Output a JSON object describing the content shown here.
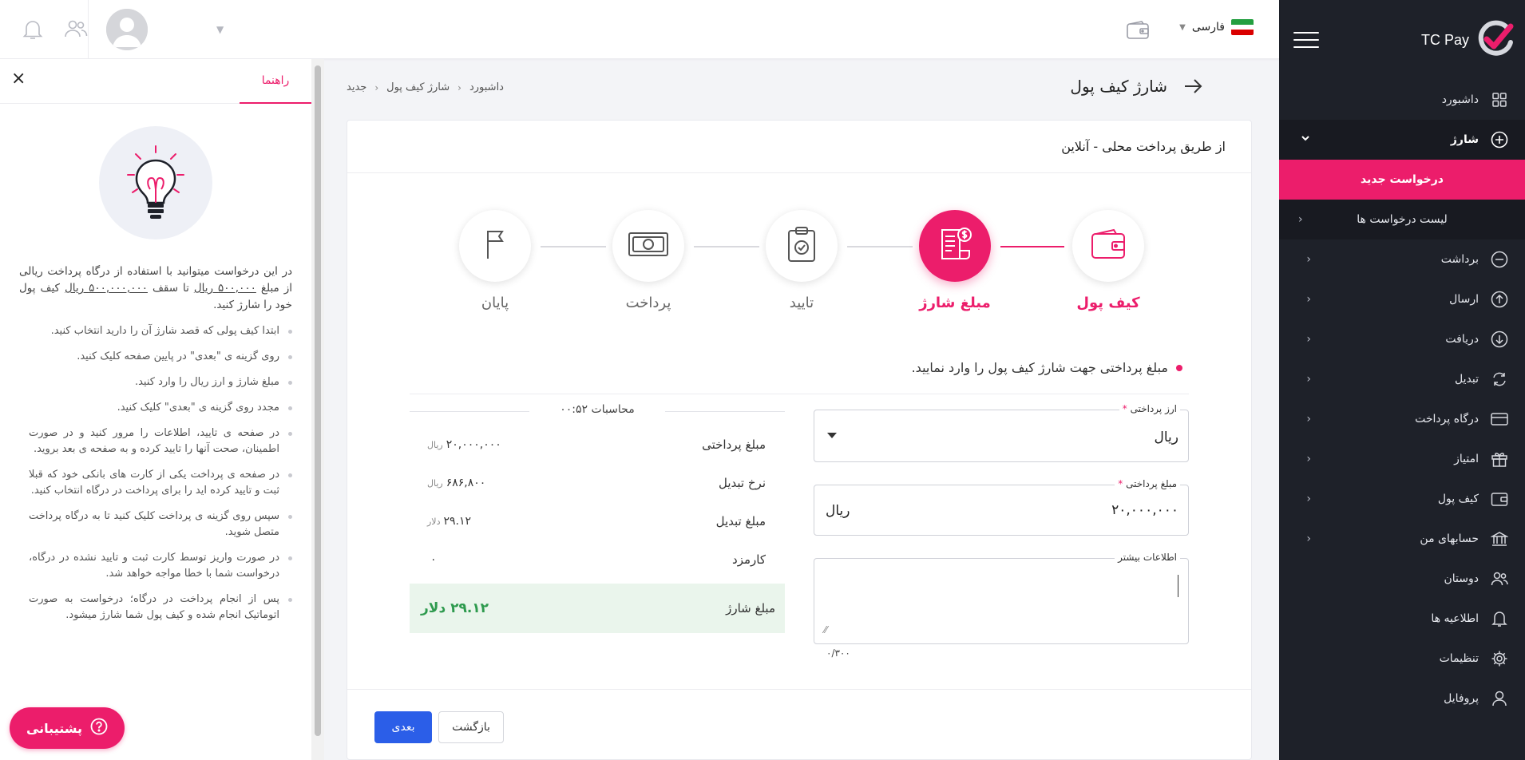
{
  "brand": {
    "name": "TC Pay"
  },
  "sidebar": {
    "items": [
      {
        "label": "داشبورد",
        "icon": "grid-icon"
      },
      {
        "label": "شارژ",
        "icon": "plus-circle-icon",
        "open": true,
        "sub": [
          {
            "label": "درخواست جدید",
            "active": true
          },
          {
            "label": "لیست درخواست ها"
          }
        ]
      },
      {
        "label": "برداشت",
        "icon": "minus-circle-icon"
      },
      {
        "label": "ارسال",
        "icon": "arrow-up-circle-icon"
      },
      {
        "label": "دریافت",
        "icon": "arrow-down-circle-icon"
      },
      {
        "label": "تبدیل",
        "icon": "refresh-icon"
      },
      {
        "label": "درگاه پرداخت",
        "icon": "card-icon"
      },
      {
        "label": "امتیاز",
        "icon": "gift-icon"
      },
      {
        "label": "کیف پول",
        "icon": "wallet-icon"
      },
      {
        "label": "حسابهای من",
        "icon": "bank-icon"
      },
      {
        "label": "دوستان",
        "icon": "users-icon"
      },
      {
        "label": "اطلاعیه ها",
        "icon": "bell-icon"
      },
      {
        "label": "تنظیمات",
        "icon": "gear-icon"
      },
      {
        "label": "پروفایل",
        "icon": "user-icon"
      }
    ]
  },
  "topbar": {
    "language": "فارسی"
  },
  "page": {
    "title": "شارژ کیف پول",
    "breadcrumb": [
      "داشبورد",
      "شارژ کیف پول",
      "جدید"
    ],
    "card_title": "از طریق پرداخت محلی - آنلاین"
  },
  "steps": [
    {
      "label": "کیف پول",
      "state": "done"
    },
    {
      "label": "مبلغ شارژ",
      "state": "active"
    },
    {
      "label": "تایید",
      "state": "pending"
    },
    {
      "label": "پرداخت",
      "state": "pending"
    },
    {
      "label": "پایان",
      "state": "pending"
    }
  ],
  "form": {
    "instruction": "مبلغ پرداختی جهت شارژ کیف پول را وارد نمایید.",
    "currency_label": "ارز پرداختی",
    "currency_value": "ریال",
    "amount_label": "مبلغ پرداختی",
    "amount_value": "۲۰,۰۰۰,۰۰۰",
    "amount_unit": "ریال",
    "more_label": "اطلاعات بیشتر",
    "more_value": "",
    "char_count": "۰/۳۰۰",
    "required_mark": "*"
  },
  "calc": {
    "title": "محاسبات ۰۰:۵۲",
    "rows": [
      {
        "label": "مبلغ پرداختی",
        "value": "۲۰,۰۰۰,۰۰۰",
        "unit": "ریال"
      },
      {
        "label": "نرخ تبدیل",
        "value": "۶۸۶,۸۰۰",
        "unit": "ریال"
      },
      {
        "label": "مبلغ تبدیل",
        "value": "۲۹.۱۲",
        "unit": "دلار"
      },
      {
        "label": "کارمزد",
        "value": "۰",
        "unit": ""
      }
    ],
    "total_label": "مبلغ شارژ",
    "total_value": "۲۹.۱۲ دلار"
  },
  "buttons": {
    "next": "بعدی",
    "back": "بازگشت"
  },
  "help": {
    "tab": "راهنما",
    "intro_1": "در این درخواست میتوانید با استفاده از درگاه پرداخت ریالی از مبلغ",
    "intro_min": "۵۰۰,۰۰۰ ریال",
    "intro_2": "تا سقف",
    "intro_max": "۵۰۰,۰۰۰,۰۰۰ ریال",
    "intro_3": "کیف پول خود را شارژ کنید.",
    "list": [
      "ابتدا کیف پولی که قصد شارژ آن را دارید انتخاب کنید.",
      "روی گزینه ی \"بعدی\" در پایین صفحه کلیک کنید.",
      "مبلغ شارژ و ارز ریال را وارد کنید.",
      "مجدد روی گزینه ی \"بعدی\" کلیک کنید.",
      "در صفحه ی تایید، اطلاعات را مرور کنید و در صورت اطمینان، صحت آنها را تایید کرده و به صفحه ی بعد بروید.",
      "در صفحه ی پرداخت یکی از کارت های بانکی خود که قبلا ثبت و تایید کرده اید را برای پرداخت در درگاه انتخاب کنید.",
      "سپس روی گزینه ی پرداخت کلیک کنید تا به درگاه پرداخت متصل شوید.",
      "در صورت واریز توسط کارت ثبت و تایید نشده در درگاه، درخواست شما با خطا مواجه خواهد شد.",
      "پس از انجام پرداخت در درگاه؛ درخواست به صورت اتوماتیک انجام شده و کیف پول شما شارژ میشود."
    ],
    "support": "پشتیبانی"
  },
  "colors": {
    "accent": "#ec1d6b",
    "sidebar": "#1e2129",
    "primary_button": "#2b5ee8",
    "success": "#2e9a4e"
  }
}
